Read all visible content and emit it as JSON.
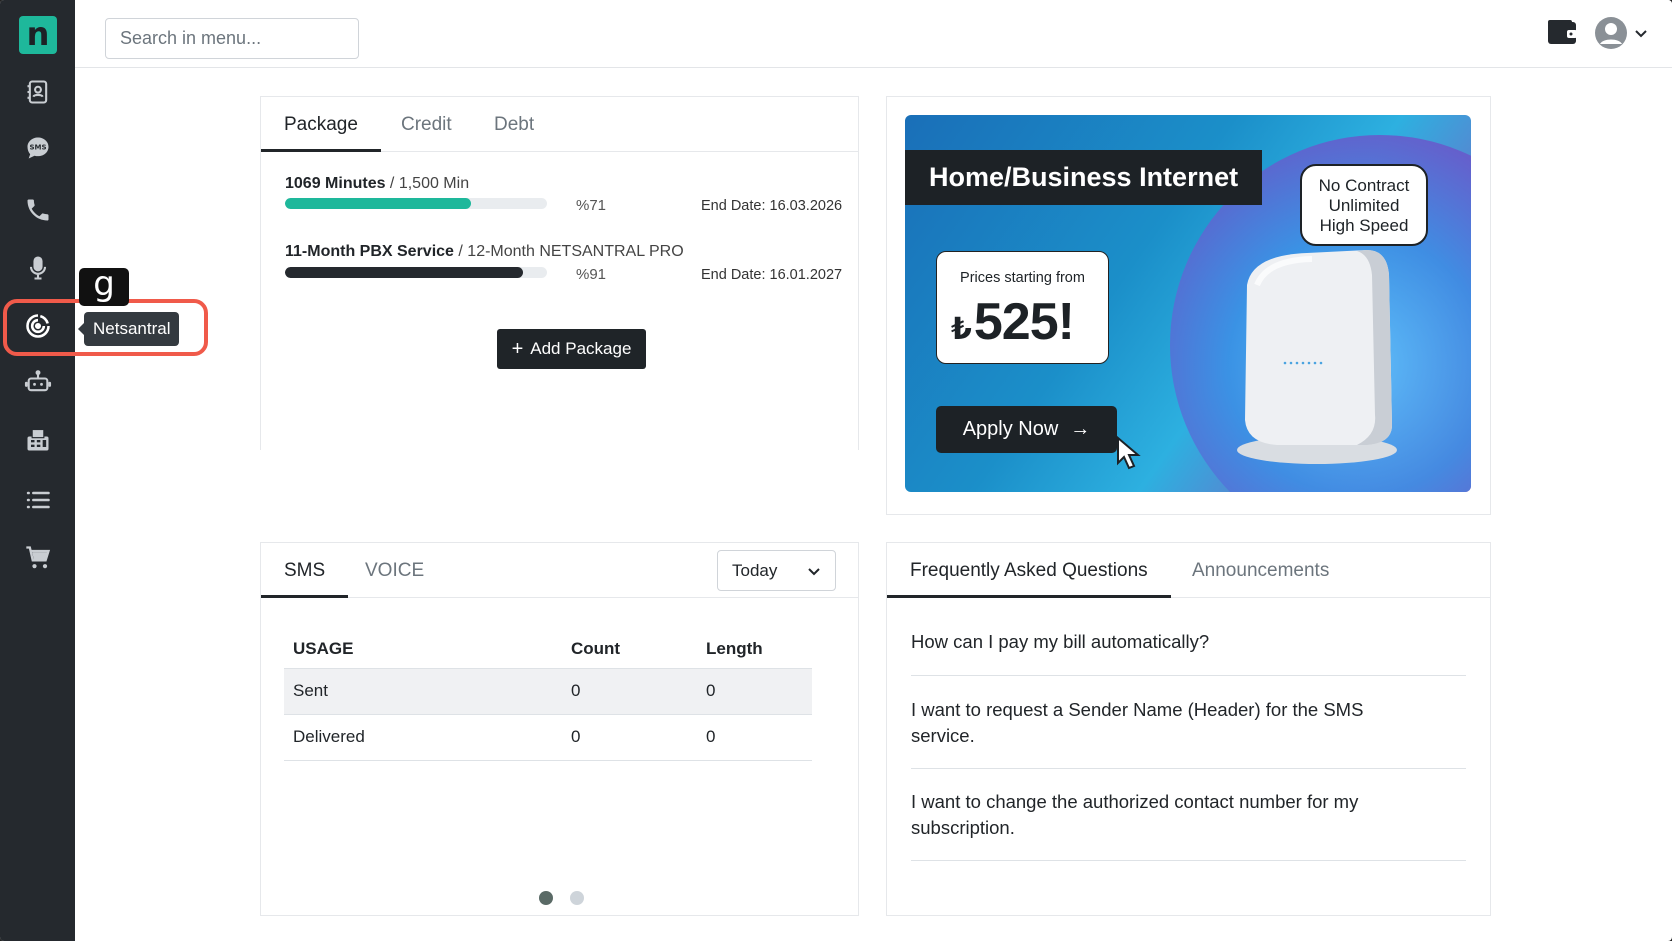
{
  "app": {
    "logo_letter": "n"
  },
  "topbar": {
    "search_placeholder": "Search in menu..."
  },
  "sidebar": {
    "items": [
      "contacts-icon",
      "sms-icon",
      "phone-icon",
      "microphone-icon",
      "netsantral-icon",
      "robot-icon",
      "fax-icon",
      "list-icon",
      "cart-icon"
    ],
    "tooltip": "Netsantral",
    "shortcut_badge": "g",
    "highlight_color": "#f05a4a"
  },
  "packages": {
    "tabs": [
      "Package",
      "Credit",
      "Debt"
    ],
    "rows": [
      {
        "title": "1069 Minutes",
        "sub": " / 1,500 Min",
        "percent_label": "%71",
        "progress": 0.71,
        "bar_color": "#1eb89b",
        "end_date": "End Date: 16.03.2026"
      },
      {
        "title": "11-Month PBX Service",
        "sub": " / 12-Month NETSANTRAL PRO",
        "percent_label": "%91",
        "progress": 0.91,
        "bar_color": "#25292e",
        "end_date": "End Date: 16.01.2027"
      }
    ],
    "add_button_plus": "+",
    "add_button": "Add Package"
  },
  "banner": {
    "headline": "Home/Business Internet",
    "bubble": [
      "No Contract",
      "Unlimited",
      "High Speed"
    ],
    "price_from": "Prices starting from",
    "currency": "₺",
    "price": "525!",
    "apply": "Apply Now",
    "apply_arrow": "→"
  },
  "usage": {
    "tabs": [
      "SMS",
      "VOICE"
    ],
    "period": "Today",
    "columns": [
      "USAGE",
      "Count",
      "Length"
    ],
    "rows": [
      [
        "Sent",
        "0",
        "0"
      ],
      [
        "Delivered",
        "0",
        "0"
      ]
    ]
  },
  "faq": {
    "tabs": [
      "Frequently Asked Questions",
      "Announcements"
    ],
    "items": [
      "How can I pay my bill automatically?",
      "I want to request a Sender Name (Header) for the SMS service.",
      "I want to change the authorized contact number for my subscription."
    ]
  }
}
